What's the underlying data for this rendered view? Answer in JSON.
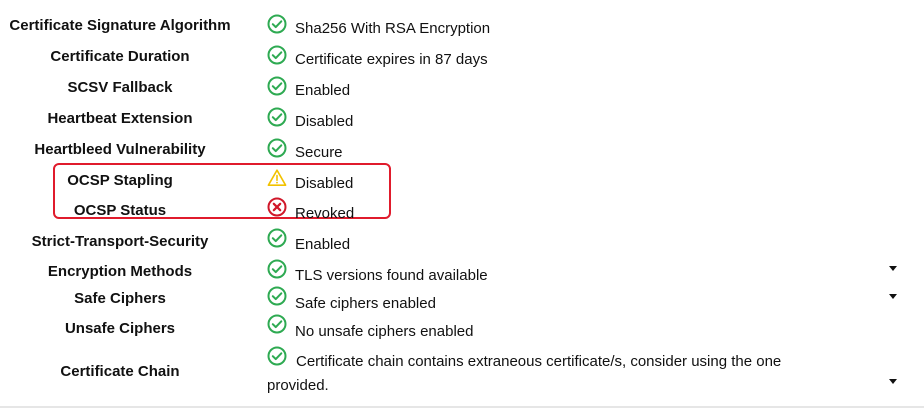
{
  "rows": [
    {
      "label": "Certificate Signature Algorithm",
      "status": "ok",
      "icon": "check-circle-icon",
      "value": "Sha256 With RSA Encryption"
    },
    {
      "label": "Certificate Duration",
      "status": "ok",
      "icon": "check-circle-icon",
      "value": "Certificate expires in 87 days"
    },
    {
      "label": "SCSV Fallback",
      "status": "ok",
      "icon": "check-circle-icon",
      "value": "Enabled"
    },
    {
      "label": "Heartbeat Extension",
      "status": "ok",
      "icon": "check-circle-icon",
      "value": "Disabled"
    },
    {
      "label": "Heartbleed Vulnerability",
      "status": "ok",
      "icon": "check-circle-icon",
      "value": "Secure"
    },
    {
      "label": "OCSP Stapling",
      "status": "warning",
      "icon": "warning-triangle-icon",
      "value": "Disabled"
    },
    {
      "label": "OCSP Status",
      "status": "error",
      "icon": "error-circle-x-icon",
      "value": "Revoked"
    },
    {
      "label": "Strict-Transport-Security",
      "status": "ok",
      "icon": "check-circle-icon",
      "value": "Enabled"
    },
    {
      "label": "Encryption Methods",
      "status": "ok",
      "icon": "check-circle-icon",
      "value": "TLS versions found available",
      "expandable": true
    },
    {
      "label": "Safe Ciphers",
      "status": "ok",
      "icon": "check-circle-icon",
      "value": "Safe ciphers enabled",
      "expandable": true
    },
    {
      "label": "Unsafe Ciphers",
      "status": "ok",
      "icon": "check-circle-icon",
      "value": "No unsafe ciphers enabled"
    },
    {
      "label": "Certificate Chain",
      "status": "ok",
      "icon": "check-circle-icon",
      "value": "Certificate chain contains extraneous certificate/s, consider using the one provided.",
      "expandable": true
    }
  ],
  "colors": {
    "ok": "#2eaa52",
    "warning": "#f2c200",
    "error": "#d0182a",
    "highlight_border": "#e01b2c"
  }
}
